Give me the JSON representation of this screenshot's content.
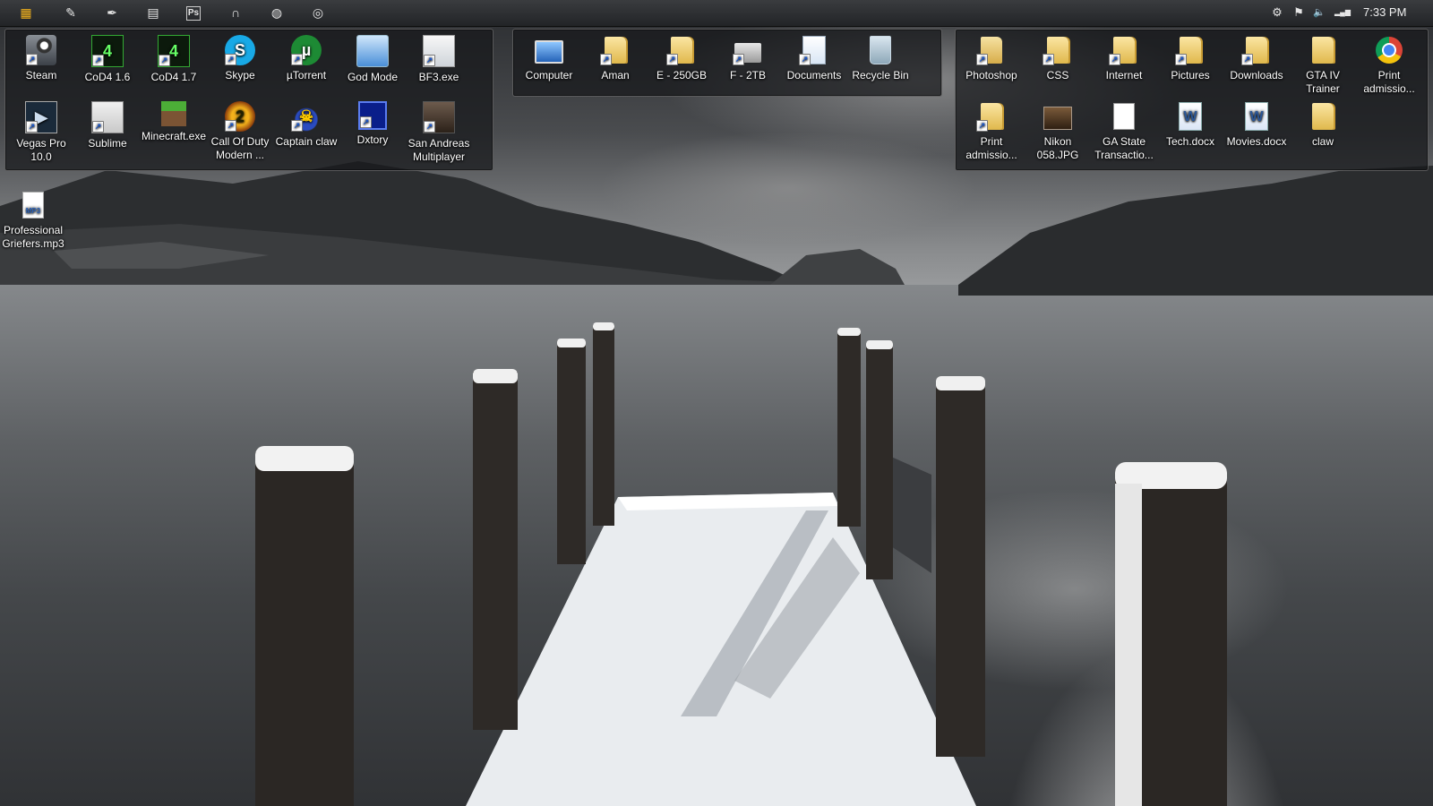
{
  "taskbar": {
    "quick_launch": [
      {
        "icon": "windows-start-icon",
        "glyph": "▦"
      },
      {
        "icon": "pen-tool-icon",
        "glyph": "✎"
      },
      {
        "icon": "feather-icon",
        "glyph": "✒"
      },
      {
        "icon": "folder-icon",
        "glyph": "▤"
      },
      {
        "icon": "photoshop-icon",
        "glyph": "Ps"
      },
      {
        "icon": "headphones-icon",
        "glyph": "∩"
      },
      {
        "icon": "globe-icon",
        "glyph": "◍"
      },
      {
        "icon": "chrome-icon",
        "glyph": "◎"
      }
    ],
    "tray": [
      {
        "icon": "steam-tray-icon",
        "glyph": "⚙"
      },
      {
        "icon": "flag-icon",
        "glyph": "⚑"
      },
      {
        "icon": "volume-icon",
        "glyph": "🔈"
      },
      {
        "icon": "network-signal-icon",
        "glyph": "▂▄▆"
      }
    ],
    "clock": "7:33 PM"
  },
  "fences": {
    "programs": {
      "items": [
        {
          "label": "Steam",
          "icon": "steam-icon",
          "shortcut": true
        },
        {
          "label": "CoD4 1.6",
          "icon": "cod4-icon",
          "shortcut": true
        },
        {
          "label": "CoD4 1.7",
          "icon": "cod4-icon",
          "shortcut": true
        },
        {
          "label": "Skype",
          "icon": "skype-icon",
          "shortcut": true
        },
        {
          "label": "µTorrent",
          "icon": "utorrent-icon",
          "shortcut": true
        },
        {
          "label": "God Mode",
          "icon": "control-panel-icon",
          "shortcut": false
        },
        {
          "label": "BF3.exe",
          "icon": "exe-file-icon",
          "shortcut": true
        },
        {
          "label": "Vegas Pro 10.0",
          "icon": "vegas-pro-icon",
          "shortcut": true
        },
        {
          "label": "Sublime",
          "icon": "sublime-text-icon",
          "shortcut": true
        },
        {
          "label": "Minecraft.exe",
          "icon": "minecraft-icon",
          "shortcut": false
        },
        {
          "label": "Call Of Duty Modern ...",
          "icon": "call-of-duty-icon",
          "shortcut": true
        },
        {
          "label": "Captain claw",
          "icon": "captain-claw-icon",
          "shortcut": true
        },
        {
          "label": "Dxtory",
          "icon": "dxtory-icon",
          "shortcut": true
        },
        {
          "label": "San Andreas Multiplayer",
          "icon": "samp-icon",
          "shortcut": true
        }
      ]
    },
    "system": {
      "items": [
        {
          "label": "Computer",
          "icon": "computer-icon",
          "shortcut": false
        },
        {
          "label": "Aman",
          "icon": "user-folder-icon",
          "shortcut": true
        },
        {
          "label": "E - 250GB",
          "icon": "folder-icon",
          "shortcut": true
        },
        {
          "label": "F - 2TB",
          "icon": "drive-icon",
          "shortcut": true
        },
        {
          "label": "Documents",
          "icon": "documents-icon",
          "shortcut": true
        },
        {
          "label": "Recycle Bin",
          "icon": "recycle-bin-icon",
          "shortcut": false
        }
      ]
    },
    "folders": {
      "items": [
        {
          "label": "Photoshop",
          "icon": "folder-icon",
          "shortcut": true
        },
        {
          "label": "CSS",
          "icon": "folder-icon",
          "shortcut": true
        },
        {
          "label": "Internet",
          "icon": "folder-icon",
          "shortcut": true
        },
        {
          "label": "Pictures",
          "icon": "folder-icon",
          "shortcut": true
        },
        {
          "label": "Downloads",
          "icon": "folder-icon",
          "shortcut": true
        },
        {
          "label": "GTA IV Trainer",
          "icon": "folder-icon",
          "shortcut": false
        },
        {
          "label": "Print admissio...",
          "icon": "chrome-icon",
          "shortcut": false
        },
        {
          "label": "Print admissio...",
          "icon": "folder-icon",
          "shortcut": true
        },
        {
          "label": "Nikon 058.JPG",
          "icon": "image-file-icon",
          "shortcut": false
        },
        {
          "label": "GA State Transactio...",
          "icon": "text-file-icon",
          "shortcut": false
        },
        {
          "label": "Tech.docx",
          "icon": "word-document-icon",
          "shortcut": false
        },
        {
          "label": "Movies.docx",
          "icon": "word-document-icon",
          "shortcut": false
        },
        {
          "label": "claw",
          "icon": "folder-icon",
          "shortcut": false
        }
      ]
    }
  },
  "desktop_loose": [
    {
      "label": "Professional Griefers.mp3",
      "icon": "mp3-file-icon",
      "badge": "MP3"
    }
  ],
  "icon_glyphs": {
    "cod": "4",
    "skype": "S",
    "utorrent": "µ",
    "vegas": "▶",
    "callduty": "2",
    "claw": "☠",
    "word": "W",
    "shortcut_arrow": "↗"
  }
}
